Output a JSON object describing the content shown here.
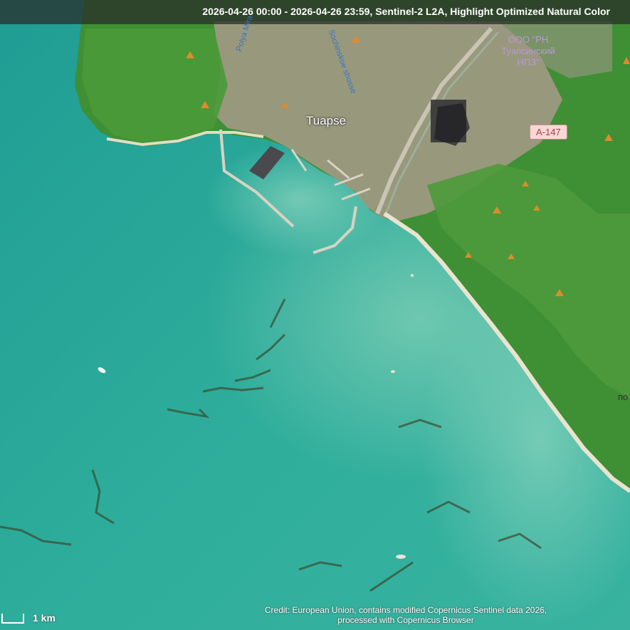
{
  "header": {
    "caption": "2026-04-26 00:00 - 2026-04-26 23:59, Sentinel-2 L2A, Highlight Optimized Natural Color"
  },
  "map": {
    "city_label": "Tuapse",
    "road_shield": "A-147",
    "poi_label": "ООО \"РН Туапсинский НПЗ\"",
    "street_labels": [
      "Polya Mira",
      "Sochinskoe shosse"
    ],
    "edge_label": "по"
  },
  "scale_bar": {
    "label": "1 km"
  },
  "credit": {
    "line1": "Credit: European Union, contains modified Copernicus Sentinel data 2026,",
    "line2": "processed with Copernicus Browser"
  },
  "colors": {
    "sea": "#2aa596",
    "sea_shallow": "#5cc4ae",
    "forest": "#3f8f34",
    "urban": "#a89a8a",
    "beach": "#e9e3cf",
    "header_bg": "#282828"
  },
  "icons": [
    "triangle-marker-icon",
    "ship-icon"
  ]
}
